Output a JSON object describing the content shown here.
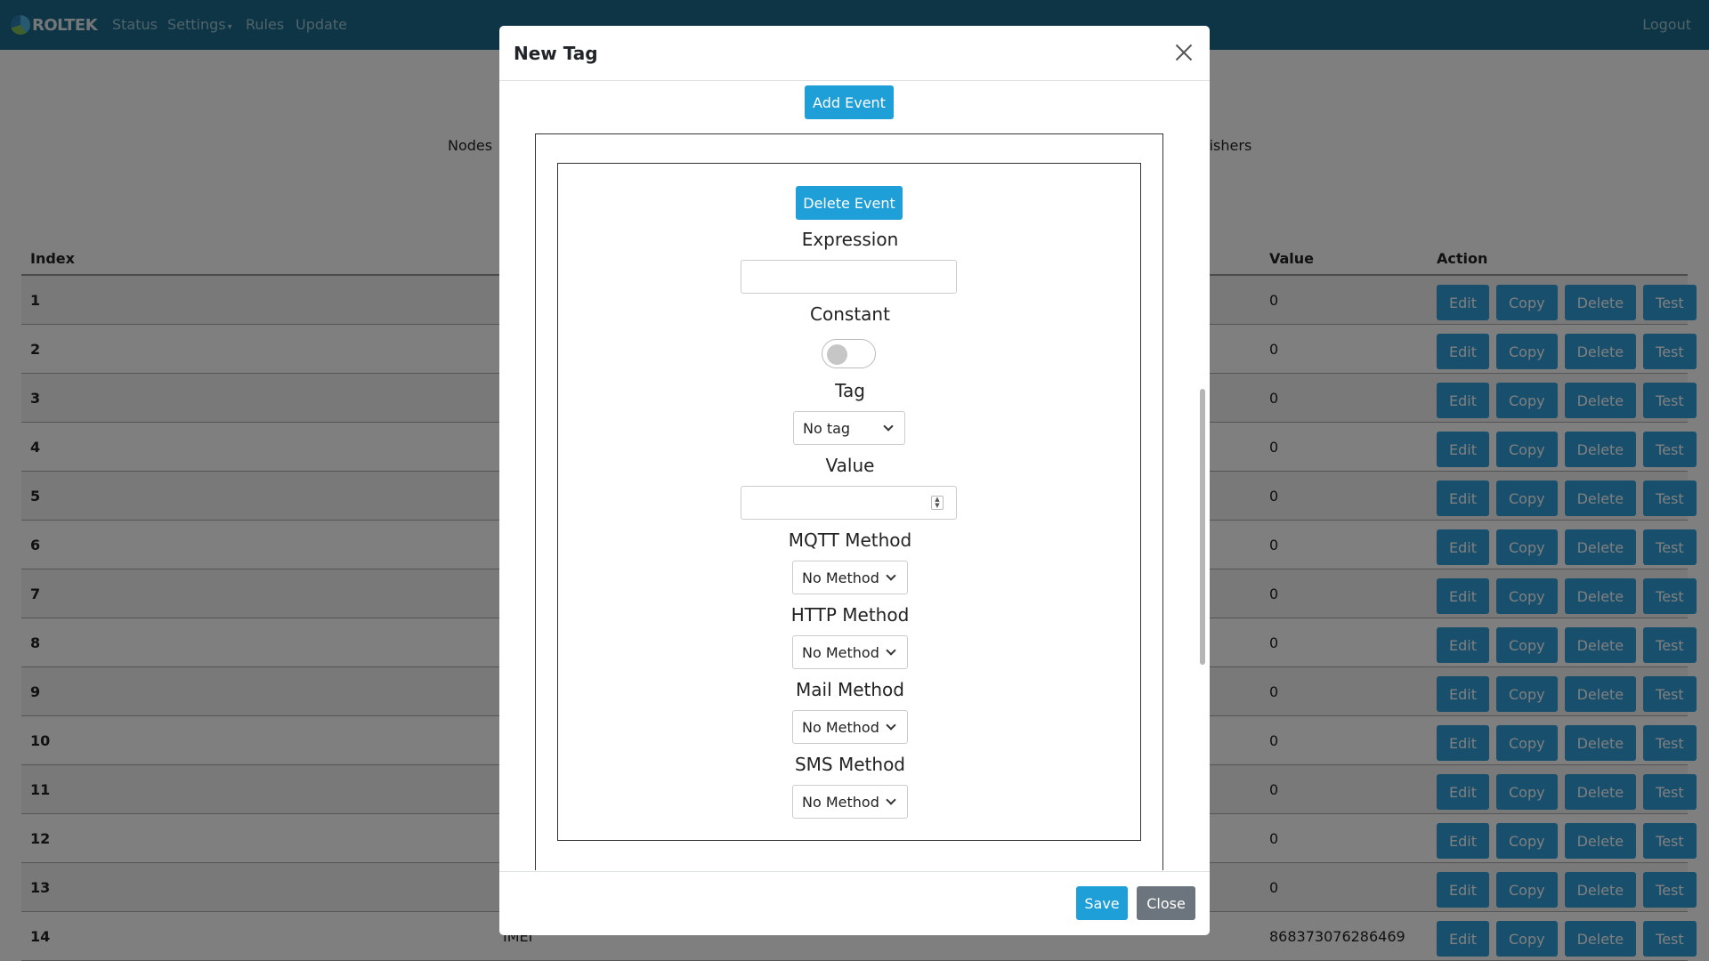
{
  "navbar": {
    "brand": "ROLTEK",
    "items": [
      "Status",
      "Settings",
      "Rules",
      "Update"
    ],
    "logout": "Logout"
  },
  "page": {
    "tab_left": "Nodes",
    "tab_right_partial": "blishers"
  },
  "table": {
    "columns": {
      "index": "Index",
      "value": "Value",
      "action": "Action"
    },
    "actions": [
      "Edit",
      "Copy",
      "Delete",
      "Test"
    ],
    "rows": [
      {
        "index": "1",
        "name": "",
        "value": "0"
      },
      {
        "index": "2",
        "name": "",
        "value": "0"
      },
      {
        "index": "3",
        "name": "",
        "value": "0"
      },
      {
        "index": "4",
        "name": "",
        "value": "0"
      },
      {
        "index": "5",
        "name": "",
        "value": "0"
      },
      {
        "index": "6",
        "name": "",
        "value": "0"
      },
      {
        "index": "7",
        "name": "",
        "value": "0"
      },
      {
        "index": "8",
        "name": "",
        "value": "0"
      },
      {
        "index": "9",
        "name": "",
        "value": "0"
      },
      {
        "index": "10",
        "name": "",
        "value": "0"
      },
      {
        "index": "11",
        "name": "",
        "value": "0"
      },
      {
        "index": "12",
        "name": "",
        "value": "0"
      },
      {
        "index": "13",
        "name": "",
        "value": "0"
      },
      {
        "index": "14",
        "name": "IMEI",
        "value": "868373076286469"
      }
    ]
  },
  "modal": {
    "title": "New Tag",
    "add_event": "Add Event",
    "event": {
      "delete_event": "Delete Event",
      "expression_label": "Expression",
      "expression_value": "",
      "constant_label": "Constant",
      "constant_on": false,
      "tag_label": "Tag",
      "tag_value": "No tag",
      "value_label": "Value",
      "value_value": "",
      "mqtt_label": "MQTT Method",
      "mqtt_value": "No Method",
      "http_label": "HTTP Method",
      "http_value": "No Method",
      "mail_label": "Mail Method",
      "mail_value": "No Method",
      "sms_label": "SMS Method",
      "sms_value": "No Method"
    },
    "save": "Save",
    "close": "Close"
  }
}
